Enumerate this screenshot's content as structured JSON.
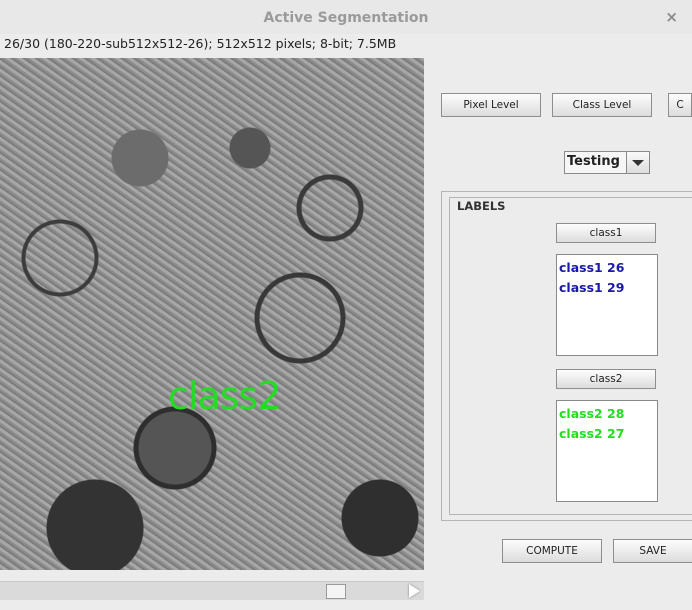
{
  "window": {
    "title": "Active Segmentation",
    "close_glyph": "×"
  },
  "image_info": "26/30 (180-220-sub512x512-26); 512x512 pixels; 8-bit; 7.5MB",
  "image_overlay": {
    "label": "class2",
    "color": "#22dd22"
  },
  "toolbar": {
    "pixel_level": "Pixel Level",
    "class_level": "Class Level",
    "third_button": "C"
  },
  "mode_select": {
    "selected": "Testing"
  },
  "labels_panel": {
    "title": "LABELS",
    "classes": [
      {
        "button": "class1",
        "color": "#1a1aa8",
        "items": [
          "class1 26",
          "class1 29"
        ]
      },
      {
        "button": "class2",
        "color": "#22dd22",
        "items": [
          "class2 28",
          "class2 27"
        ]
      }
    ]
  },
  "actions": {
    "compute": "COMPUTE",
    "save": "SAVE"
  }
}
